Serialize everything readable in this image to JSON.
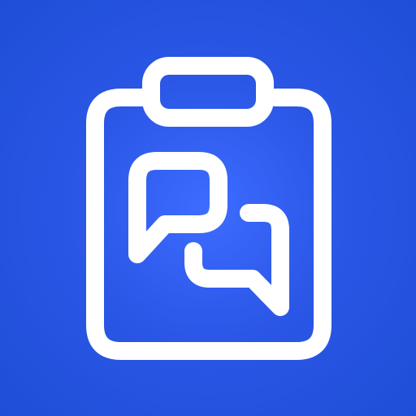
{
  "app_icon": {
    "icon": "clipboard-chat-icon",
    "background_colors": [
      "#3d6cff",
      "#2b56e6",
      "#1e4fd6"
    ],
    "foreground_color": "#ffffff"
  }
}
